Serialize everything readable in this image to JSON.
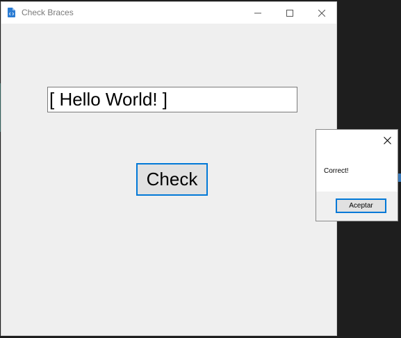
{
  "window": {
    "title": "Check Braces",
    "icon": "code-file-icon",
    "accent_color": "#0078d7"
  },
  "form": {
    "input_value": "[ Hello World! ]",
    "check_label": "Check"
  },
  "dialog": {
    "message": "Correct!",
    "ok_label": "Aceptar"
  }
}
